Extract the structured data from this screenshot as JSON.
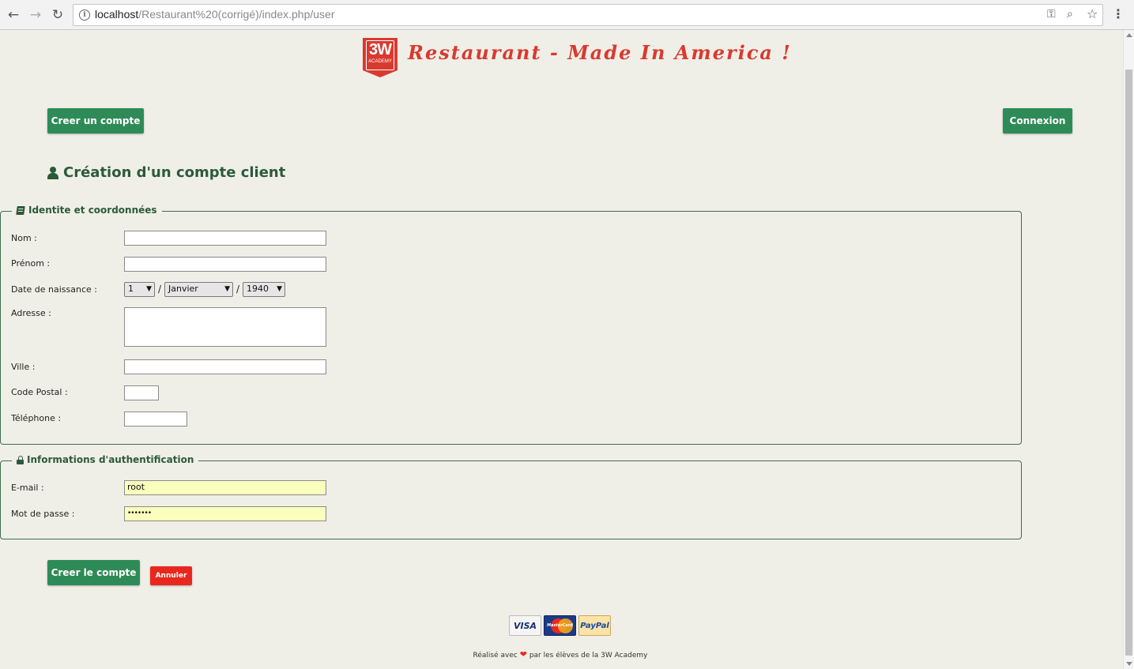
{
  "browser": {
    "url_host": "localhost",
    "url_path": "/Restaurant%20(corrigé)/index.php/user",
    "icons": [
      "back-icon",
      "forward-icon",
      "reload-icon",
      "info-icon",
      "key-icon",
      "zoom-icon",
      "star-icon",
      "menu-icon"
    ]
  },
  "header": {
    "logo_text": "3W",
    "logo_subtext": "ACADEMY",
    "site_title": "Restaurant - Made In America !"
  },
  "nav": {
    "create_account": "Creer un compte",
    "login": "Connexion"
  },
  "page": {
    "heading": "Création d'un compte client"
  },
  "identity": {
    "legend": "Identite et coordonnées",
    "nom_label": "Nom :",
    "nom_value": "",
    "prenom_label": "Prénom :",
    "prenom_value": "",
    "birth_label": "Date de naissance :",
    "birth_day": "1",
    "birth_month": "Janvier",
    "birth_year": "1940",
    "birth_sep": "/",
    "adresse_label": "Adresse :",
    "adresse_value": "",
    "ville_label": "Ville :",
    "ville_value": "",
    "cp_label": "Code Postal :",
    "cp_value": "",
    "tel_label": "Téléphone :",
    "tel_value": ""
  },
  "auth": {
    "legend": "Informations d'authentification",
    "email_label": "E-mail :",
    "email_value": "root",
    "password_label": "Mot de passe :",
    "password_mask": "•••••••"
  },
  "actions": {
    "submit": "Creer le compte",
    "cancel": "Annuler"
  },
  "payments": {
    "visa": "VISA",
    "mastercard": "MasterCard",
    "paypal": "PayPal"
  },
  "footer": {
    "text_before": "Réalisé avec",
    "heart": "❤",
    "text_after": "par les élèves de la 3W Academy"
  },
  "colors": {
    "page_bg": "#f0efe7",
    "green": "#2e8b57",
    "heading_green": "#2b5a3a",
    "brand_red": "#d83a30",
    "cancel_red": "#e8281e",
    "autofill_yellow": "#faffbd"
  }
}
